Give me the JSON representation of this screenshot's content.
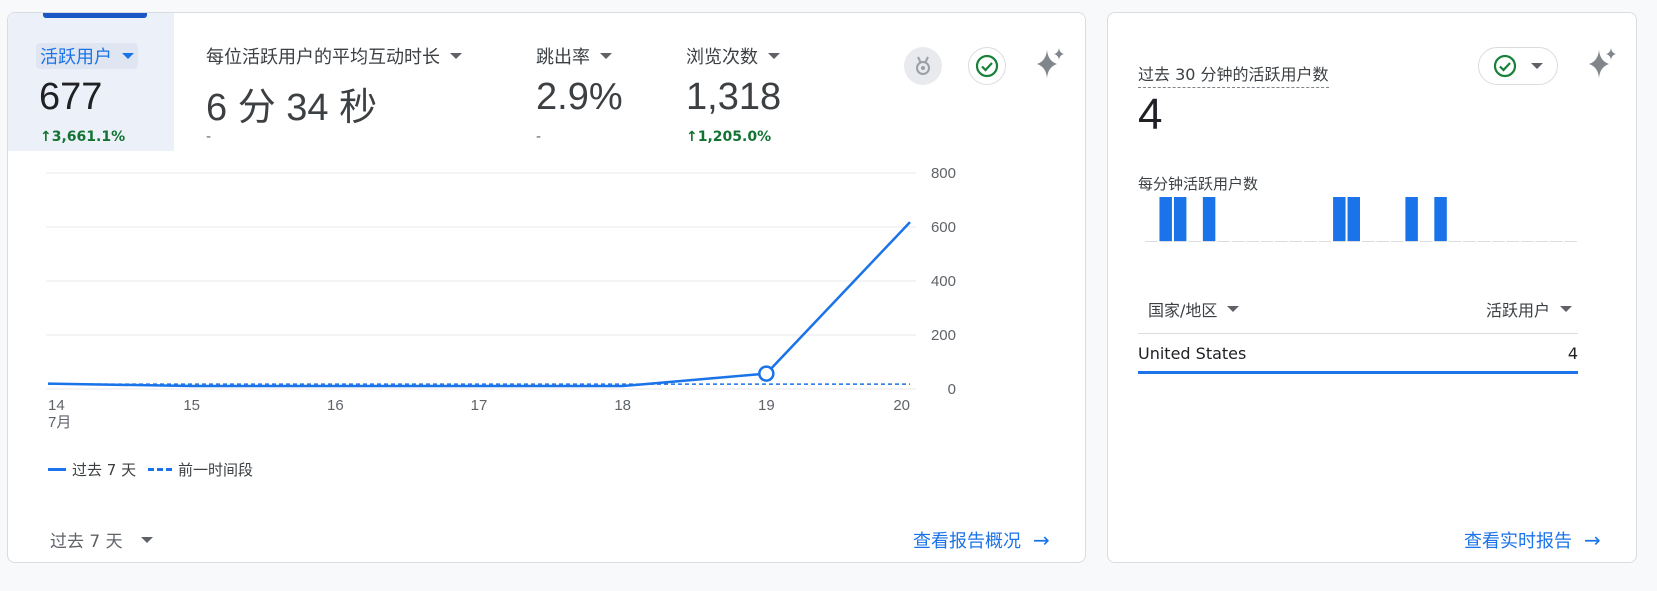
{
  "metrics": [
    {
      "label": "活跃用户",
      "value": "677",
      "change": "3,661.1%",
      "change_dir": "up",
      "selected": true
    },
    {
      "label": "每位活跃用户的平均互动时长",
      "value": "6 分 34 秒",
      "change": "-",
      "change_dir": "none",
      "selected": false
    },
    {
      "label": "跳出率",
      "value": "2.9%",
      "change": "-",
      "change_dir": "none",
      "selected": false
    },
    {
      "label": "浏览次数",
      "value": "1,318",
      "change": "1,205.0%",
      "change_dir": "up",
      "selected": false
    }
  ],
  "header_icons": [
    "insight-badge-icon",
    "check-circle-icon",
    "sparkle-icon"
  ],
  "chart_data": {
    "type": "line",
    "x": [
      "14",
      "15",
      "16",
      "17",
      "18",
      "19",
      "20"
    ],
    "x_sublabel": "7月",
    "ylim": [
      0,
      800
    ],
    "y_ticks": [
      "0",
      "200",
      "400",
      "600",
      "800"
    ],
    "grid": true,
    "y_axis_position": "right",
    "series": [
      {
        "name": "过去 7 天",
        "style": "solid",
        "color": "#1a73e8",
        "values": [
          20,
          11,
          11,
          11,
          11,
          57,
          618
        ]
      },
      {
        "name": "前一时间段",
        "style": "dashed",
        "color": "#1a73e8",
        "values": [
          18,
          18,
          18,
          18,
          18,
          18,
          18
        ]
      }
    ]
  },
  "footer": {
    "range_label": "过去 7 天",
    "link_label": "查看报告概况"
  },
  "realtime": {
    "title": "过去 30 分钟的活跃用户数",
    "value": "4",
    "subtitle": "每分钟活跃用户数",
    "per_minute": [
      0,
      1,
      1,
      0,
      1,
      0,
      0,
      0,
      0,
      0,
      0,
      0,
      0,
      1,
      1,
      0,
      0,
      0,
      1,
      0,
      1,
      0,
      0,
      0,
      0,
      0,
      0,
      0,
      0,
      0
    ],
    "col_country": "国家/地区",
    "col_users": "活跃用户",
    "rows": [
      {
        "name": "United States",
        "value": "4"
      }
    ],
    "link_label": "查看实时报告"
  },
  "colors": {
    "accent": "#1a73e8",
    "positive": "#137333",
    "selected_bg": "#ecf1f9"
  }
}
